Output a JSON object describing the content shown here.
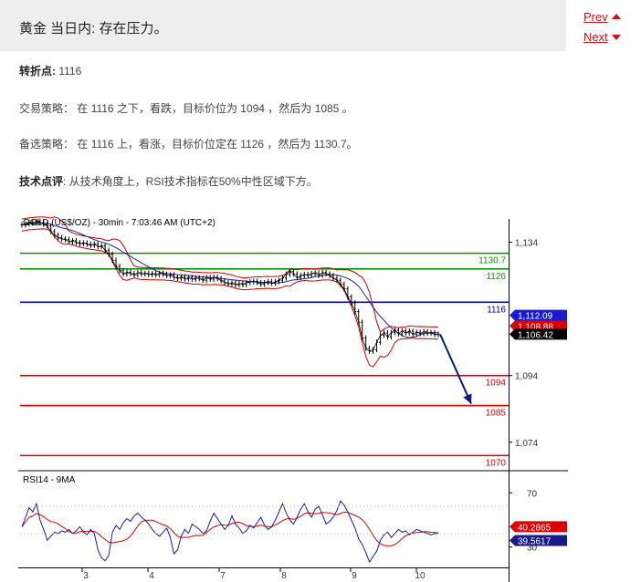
{
  "header": {
    "title": "黄金 当日内: 存在压力。"
  },
  "nav": {
    "prev_label": "Prev",
    "next_label": "Next"
  },
  "analysis": {
    "pivot_label": "转折点:",
    "pivot_value": "1116",
    "strategy_label": "交易策略：",
    "strategy_text": "在 1116 之下，看跌，目标价位为 1094 ，然后为 1085 。",
    "alt_label": "备选策略：",
    "alt_text": "在 1116 上，看涨，目标价位定在 1126 ，然后为 1130.7。",
    "tech_label": "技术点评",
    "tech_text": ": 从技术角度上，RSI技术指标在50%中性区域下方。"
  },
  "chart_data": {
    "type": "line",
    "title": "GOLD (US$/OZ) - 30min - 7:03:46 AM (UTC+2)",
    "price_axis": {
      "ylim": [
        1066,
        1141
      ],
      "ticks": [
        1134,
        1094,
        1074
      ]
    },
    "x_ticks": [
      "3",
      "4",
      "7",
      "8",
      "9",
      "10"
    ],
    "levels": [
      {
        "value": 1130.7,
        "label": "1130.7",
        "color": "#009900"
      },
      {
        "value": 1126,
        "label": "1126",
        "color": "#009900"
      },
      {
        "value": 1116,
        "label": "1116",
        "color": "#0000cc"
      },
      {
        "value": 1094,
        "label": "1094",
        "color": "#dd0000"
      },
      {
        "value": 1085,
        "label": "1085",
        "color": "#dd0000"
      },
      {
        "value": 1070,
        "label": "1070",
        "color": "#dd0000"
      }
    ],
    "price_tags": [
      {
        "value": 1112.09,
        "label": "1,112.09",
        "bg": "#1a1acc"
      },
      {
        "value": 1108.88,
        "label": "1,108.88",
        "bg": "#dd0000"
      },
      {
        "value": 1106.42,
        "label": "1,106.42",
        "bg": "#000000"
      }
    ],
    "price_series": {
      "name": "GOLD",
      "x": [
        0,
        4,
        8,
        12,
        16,
        20,
        24,
        28,
        32,
        36,
        40,
        44,
        48,
        52,
        56,
        60,
        64,
        68,
        72,
        76,
        80,
        84,
        88,
        92,
        96,
        100,
        104,
        108,
        112,
        116,
        120,
        124,
        128,
        132,
        136,
        140,
        144,
        148,
        152,
        156,
        160,
        164,
        168,
        172,
        176,
        180,
        184,
        188,
        192,
        196,
        200,
        204,
        208,
        212,
        216,
        220,
        224,
        228,
        232,
        236,
        240,
        244,
        248,
        252,
        256,
        260,
        264,
        268,
        272,
        276,
        280,
        284,
        288,
        292,
        296,
        300,
        304,
        308,
        312,
        316,
        320,
        324,
        328,
        332,
        336,
        340,
        344,
        348,
        352,
        356,
        360,
        364,
        368,
        372,
        376,
        380,
        384,
        388,
        392,
        396,
        400,
        404,
        408,
        412,
        416,
        420,
        424,
        428,
        432,
        436,
        440,
        444,
        448,
        452,
        456,
        460
      ],
      "values": [
        1139.2,
        1139.5,
        1140.0,
        1139.7,
        1140.3,
        1139.9,
        1139.4,
        1138.9,
        1137.2,
        1136.1,
        1135.4,
        1135.0,
        1134.8,
        1134.2,
        1134.5,
        1133.9,
        1133.6,
        1133.8,
        1133.4,
        1133.1,
        1133.5,
        1132.7,
        1132.9,
        1131.6,
        1130.4,
        1128.6,
        1126.8,
        1125.5,
        1124.5,
        1125.0,
        1124.6,
        1124.2,
        1124.9,
        1124.5,
        1124.7,
        1124.3,
        1124.6,
        1124.2,
        1124.7,
        1124.4,
        1124.0,
        1124.2,
        1123.5,
        1123.2,
        1123.6,
        1123.0,
        1123.4,
        1122.9,
        1123.3,
        1123.1,
        1122.6,
        1123.4,
        1122.9,
        1123.5,
        1123.1,
        1122.5,
        1121.9,
        1121.5,
        1121.8,
        1121.2,
        1121.6,
        1121.3,
        1121.9,
        1122.1,
        1122.3,
        1121.9,
        1121.4,
        1121.9,
        1122.2,
        1121.7,
        1122.2,
        1122.6,
        1123.3,
        1124.4,
        1125.3,
        1124.5,
        1123.4,
        1124.0,
        1124.3,
        1124.1,
        1124.6,
        1124.8,
        1124.1,
        1124.9,
        1124.5,
        1124.0,
        1123.2,
        1122.6,
        1121.4,
        1120.0,
        1117.6,
        1115.8,
        1113.2,
        1110.0,
        1105.3,
        1102.2,
        1101.3,
        1101.8,
        1104.0,
        1106.1,
        1106.8,
        1105.6,
        1106.9,
        1107.6,
        1106.5,
        1107.4,
        1106.8,
        1107.3,
        1106.4,
        1107.0,
        1106.6,
        1107.2,
        1106.7,
        1106.9,
        1106.3,
        1106.4
      ]
    },
    "rsi_panel": {
      "title": "RSI14 - 9MA",
      "ylim": [
        15,
        85
      ],
      "ticks": [
        70,
        30
      ],
      "tags": [
        {
          "value": 40.2865,
          "label": "40.2865",
          "bg": "#dd0000"
        },
        {
          "value": 39.5617,
          "label": "39.5617",
          "bg": "#1a1a8c"
        }
      ],
      "rsi_values": [
        45,
        52,
        59,
        56,
        62,
        50,
        43,
        35,
        38,
        41,
        40,
        42,
        41,
        43,
        40,
        42,
        45,
        41,
        39,
        43,
        40,
        28,
        22,
        20,
        24,
        41,
        46,
        43,
        48,
        51,
        49,
        53,
        55,
        52,
        50,
        47,
        43,
        40,
        38,
        41,
        44,
        37,
        25,
        28,
        38,
        43,
        40,
        47,
        45,
        43,
        40,
        42,
        49,
        55,
        51,
        47,
        43,
        46,
        53,
        47,
        44,
        40,
        42,
        46,
        44,
        48,
        52,
        46,
        43,
        45,
        50,
        56,
        62,
        55,
        50,
        47,
        52,
        58,
        62,
        56,
        52,
        58,
        60,
        54,
        47,
        49,
        52,
        57,
        64,
        61,
        56,
        50,
        44,
        36,
        32,
        26,
        19,
        23,
        27,
        35,
        39,
        41,
        37,
        40,
        43,
        41,
        42,
        39,
        41,
        43,
        42,
        41,
        40,
        39,
        40,
        40
      ]
    }
  }
}
